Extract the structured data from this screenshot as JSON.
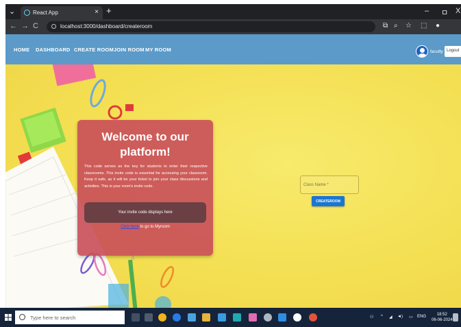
{
  "browser": {
    "tab_title": "React App",
    "tab_close": "×",
    "new_tab": "+",
    "url": "localhost:3000/dashboard/createroom",
    "back": "←",
    "forward": "→",
    "reload": "C",
    "minimize": "–",
    "maximize": "ㅁ",
    "close": "X"
  },
  "nav": {
    "links": [
      "HOME",
      "DASHBOARD",
      "CREATE ROOM",
      "JOIN ROOM",
      "MY ROOM"
    ],
    "username": "faculty",
    "logout": "Logout"
  },
  "card": {
    "title": "Welcome to our platform!",
    "description": "This code serves as the key for students to enter their respective classrooms. This invite code is essential for accessing your classroom. Keep it safe, as it will be your ticket to join your class discussions and activities. This is your room's invite code.",
    "invite_placeholder": "Your invite code displays here",
    "link_text": "Click here",
    "link_suffix": " to go to Myroom"
  },
  "form": {
    "class_name_label": "Class Name *",
    "create_button": "CREATEROOM"
  },
  "taskbar": {
    "search_placeholder": "Type here to search",
    "language": "ENG",
    "time": "18:52",
    "date": "06-06-2024"
  },
  "colors": {
    "nav_bg": "#5b9ac9",
    "card_bg": "#c94e5a",
    "button_blue": "#1b76d1",
    "background_yellow": "#f4df52"
  }
}
